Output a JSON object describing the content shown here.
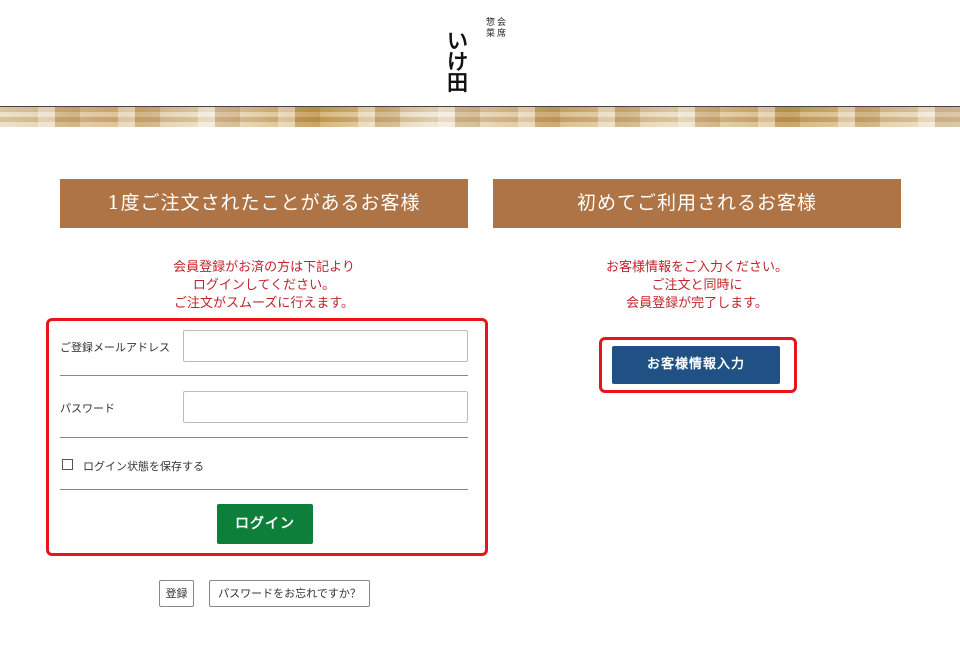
{
  "header": {
    "logo_main": "いけ田",
    "logo_sub_1": "会席",
    "logo_sub_2": "惣菜"
  },
  "left": {
    "heading": "1度ご注文されたことがあるお客様",
    "notice_lines": [
      "会員登録がお済の方は下記より",
      "ログインしてください。",
      "ご注文がスムーズに行えます。"
    ],
    "email_label": "ご登録メールアドレス",
    "email_value": "",
    "password_label": "パスワード",
    "password_value": "",
    "remember_label": "ログイン状態を保存する",
    "remember_checked": false,
    "login_button": "ログイン",
    "register_button": "登録",
    "forgot_button": "パスワードをお忘れですか？"
  },
  "right": {
    "heading": "初めてご利用されるお客様",
    "notice_lines": [
      "お客様情報をご入力ください。",
      "ご注文と同時に",
      "会員登録が完了します。"
    ],
    "button": "お客様情報入力"
  },
  "colors": {
    "heading_bg": "#ae7445",
    "notice_text": "#c0242b",
    "login_button": "#0e7f3a",
    "customer_button": "#1f5185",
    "highlight_outline": "#e8141c"
  }
}
